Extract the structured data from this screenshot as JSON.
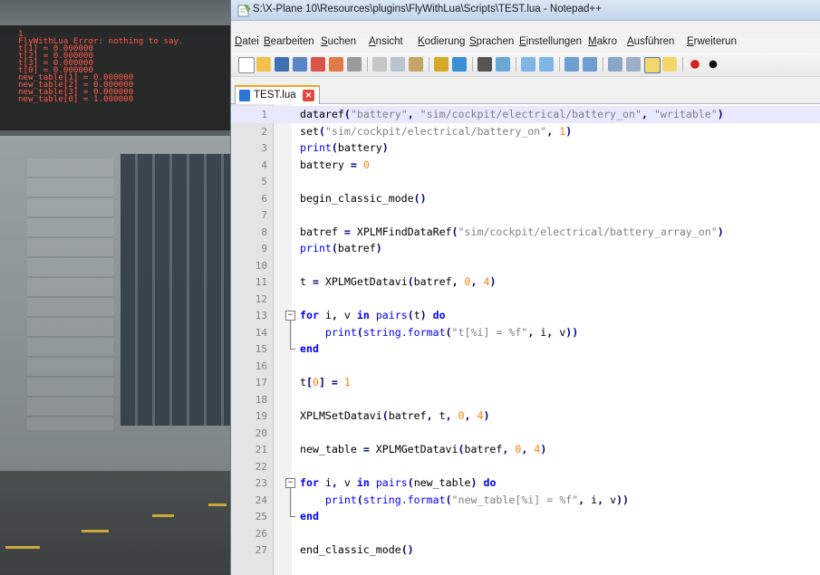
{
  "overlay": {
    "lines": [
      "1",
      "FlyWithLua Error: nothing to say.",
      "t[1] = 0.000000",
      "t[2] = 0.000000",
      "t[3] = 0.000000",
      "t[0] = 0.000000",
      "new_table[1] = 0.000000",
      "new_table[2] = 0.000000",
      "new_table[3] = 0.000000",
      "new_table[0] = 1.000000"
    ],
    "color": "#ff5a4a"
  },
  "window": {
    "title": "S:\\X-Plane 10\\Resources\\plugins\\FlyWithLua\\Scripts\\TEST.lua - Notepad++"
  },
  "menu": {
    "items": [
      "Datei",
      "Bearbeiten",
      "Suchen",
      "Ansicht",
      "Kodierung",
      "Sprachen",
      "Einstellungen",
      "Makro",
      "Ausführen",
      "Erweiterun"
    ]
  },
  "tab": {
    "label": "TEST.lua",
    "close_glyph": "×"
  },
  "editor": {
    "current_line": 1,
    "lines": [
      [
        {
          "t": "dataref",
          "c": "id"
        },
        {
          "t": "(",
          "c": "o"
        },
        {
          "t": "\"battery\"",
          "c": "s"
        },
        {
          "t": ", ",
          "c": "o"
        },
        {
          "t": "\"sim/cockpit/electrical/battery_on\"",
          "c": "s"
        },
        {
          "t": ", ",
          "c": "o"
        },
        {
          "t": "\"writable\"",
          "c": "s"
        },
        {
          "t": ")",
          "c": "o"
        }
      ],
      [
        {
          "t": "set",
          "c": "id"
        },
        {
          "t": "(",
          "c": "o"
        },
        {
          "t": "\"sim/cockpit/electrical/battery_on\"",
          "c": "s"
        },
        {
          "t": ", ",
          "c": "o"
        },
        {
          "t": "1",
          "c": "n"
        },
        {
          "t": ")",
          "c": "o"
        }
      ],
      [
        {
          "t": "print",
          "c": "f"
        },
        {
          "t": "(",
          "c": "o"
        },
        {
          "t": "battery",
          "c": "id"
        },
        {
          "t": ")",
          "c": "o"
        }
      ],
      [
        {
          "t": "battery ",
          "c": "id"
        },
        {
          "t": "=",
          "c": "o"
        },
        {
          "t": " ",
          "c": "id"
        },
        {
          "t": "0",
          "c": "n"
        }
      ],
      [],
      [
        {
          "t": "begin_classic_mode",
          "c": "id"
        },
        {
          "t": "()",
          "c": "o"
        }
      ],
      [],
      [
        {
          "t": "batref ",
          "c": "id"
        },
        {
          "t": "=",
          "c": "o"
        },
        {
          "t": " XPLMFindDataRef",
          "c": "id"
        },
        {
          "t": "(",
          "c": "o"
        },
        {
          "t": "\"sim/cockpit/electrical/battery_array_on\"",
          "c": "s"
        },
        {
          "t": ")",
          "c": "o"
        }
      ],
      [
        {
          "t": "print",
          "c": "f"
        },
        {
          "t": "(",
          "c": "o"
        },
        {
          "t": "batref",
          "c": "id"
        },
        {
          "t": ")",
          "c": "o"
        }
      ],
      [],
      [
        {
          "t": "t ",
          "c": "id"
        },
        {
          "t": "=",
          "c": "o"
        },
        {
          "t": " XPLMGetDatavi",
          "c": "id"
        },
        {
          "t": "(",
          "c": "o"
        },
        {
          "t": "batref",
          "c": "id"
        },
        {
          "t": ", ",
          "c": "o"
        },
        {
          "t": "0",
          "c": "n"
        },
        {
          "t": ", ",
          "c": "o"
        },
        {
          "t": "4",
          "c": "n"
        },
        {
          "t": ")",
          "c": "o"
        }
      ],
      [],
      [
        {
          "t": "for",
          "c": "k"
        },
        {
          "t": " i",
          "c": "id"
        },
        {
          "t": ",",
          "c": "o"
        },
        {
          "t": " v ",
          "c": "id"
        },
        {
          "t": "in",
          "c": "k"
        },
        {
          "t": " ",
          "c": "id"
        },
        {
          "t": "pairs",
          "c": "f"
        },
        {
          "t": "(",
          "c": "o"
        },
        {
          "t": "t",
          "c": "id"
        },
        {
          "t": ")",
          "c": "o"
        },
        {
          "t": " ",
          "c": "id"
        },
        {
          "t": "do",
          "c": "k"
        }
      ],
      [
        {
          "t": "    ",
          "c": "id"
        },
        {
          "t": "print",
          "c": "f"
        },
        {
          "t": "(",
          "c": "o"
        },
        {
          "t": "string.format",
          "c": "f"
        },
        {
          "t": "(",
          "c": "o"
        },
        {
          "t": "\"t[%i] = %f\"",
          "c": "s"
        },
        {
          "t": ", ",
          "c": "o"
        },
        {
          "t": "i",
          "c": "id"
        },
        {
          "t": ", ",
          "c": "o"
        },
        {
          "t": "v",
          "c": "id"
        },
        {
          "t": "))",
          "c": "o"
        }
      ],
      [
        {
          "t": "end",
          "c": "k"
        }
      ],
      [],
      [
        {
          "t": "t",
          "c": "id"
        },
        {
          "t": "[",
          "c": "o"
        },
        {
          "t": "0",
          "c": "n"
        },
        {
          "t": "]",
          "c": "o"
        },
        {
          "t": " ",
          "c": "id"
        },
        {
          "t": "=",
          "c": "o"
        },
        {
          "t": " ",
          "c": "id"
        },
        {
          "t": "1",
          "c": "n"
        }
      ],
      [],
      [
        {
          "t": "XPLMSetDatavi",
          "c": "id"
        },
        {
          "t": "(",
          "c": "o"
        },
        {
          "t": "batref",
          "c": "id"
        },
        {
          "t": ", ",
          "c": "o"
        },
        {
          "t": "t",
          "c": "id"
        },
        {
          "t": ", ",
          "c": "o"
        },
        {
          "t": "0",
          "c": "n"
        },
        {
          "t": ", ",
          "c": "o"
        },
        {
          "t": "4",
          "c": "n"
        },
        {
          "t": ")",
          "c": "o"
        }
      ],
      [],
      [
        {
          "t": "new_table ",
          "c": "id"
        },
        {
          "t": "=",
          "c": "o"
        },
        {
          "t": " XPLMGetDatavi",
          "c": "id"
        },
        {
          "t": "(",
          "c": "o"
        },
        {
          "t": "batref",
          "c": "id"
        },
        {
          "t": ", ",
          "c": "o"
        },
        {
          "t": "0",
          "c": "n"
        },
        {
          "t": ", ",
          "c": "o"
        },
        {
          "t": "4",
          "c": "n"
        },
        {
          "t": ")",
          "c": "o"
        }
      ],
      [],
      [
        {
          "t": "for",
          "c": "k"
        },
        {
          "t": " i",
          "c": "id"
        },
        {
          "t": ",",
          "c": "o"
        },
        {
          "t": " v ",
          "c": "id"
        },
        {
          "t": "in",
          "c": "k"
        },
        {
          "t": " ",
          "c": "id"
        },
        {
          "t": "pairs",
          "c": "f"
        },
        {
          "t": "(",
          "c": "o"
        },
        {
          "t": "new_table",
          "c": "id"
        },
        {
          "t": ")",
          "c": "o"
        },
        {
          "t": " ",
          "c": "id"
        },
        {
          "t": "do",
          "c": "k"
        }
      ],
      [
        {
          "t": "    ",
          "c": "id"
        },
        {
          "t": "print",
          "c": "f"
        },
        {
          "t": "(",
          "c": "o"
        },
        {
          "t": "string.format",
          "c": "f"
        },
        {
          "t": "(",
          "c": "o"
        },
        {
          "t": "\"new_table[%i] = %f\"",
          "c": "s"
        },
        {
          "t": ", ",
          "c": "o"
        },
        {
          "t": "i",
          "c": "id"
        },
        {
          "t": ", ",
          "c": "o"
        },
        {
          "t": "v",
          "c": "id"
        },
        {
          "t": "))",
          "c": "o"
        }
      ],
      [
        {
          "t": "end",
          "c": "k"
        }
      ],
      [],
      [
        {
          "t": "end_classic_mode",
          "c": "id"
        },
        {
          "t": "()",
          "c": "o"
        }
      ]
    ]
  }
}
